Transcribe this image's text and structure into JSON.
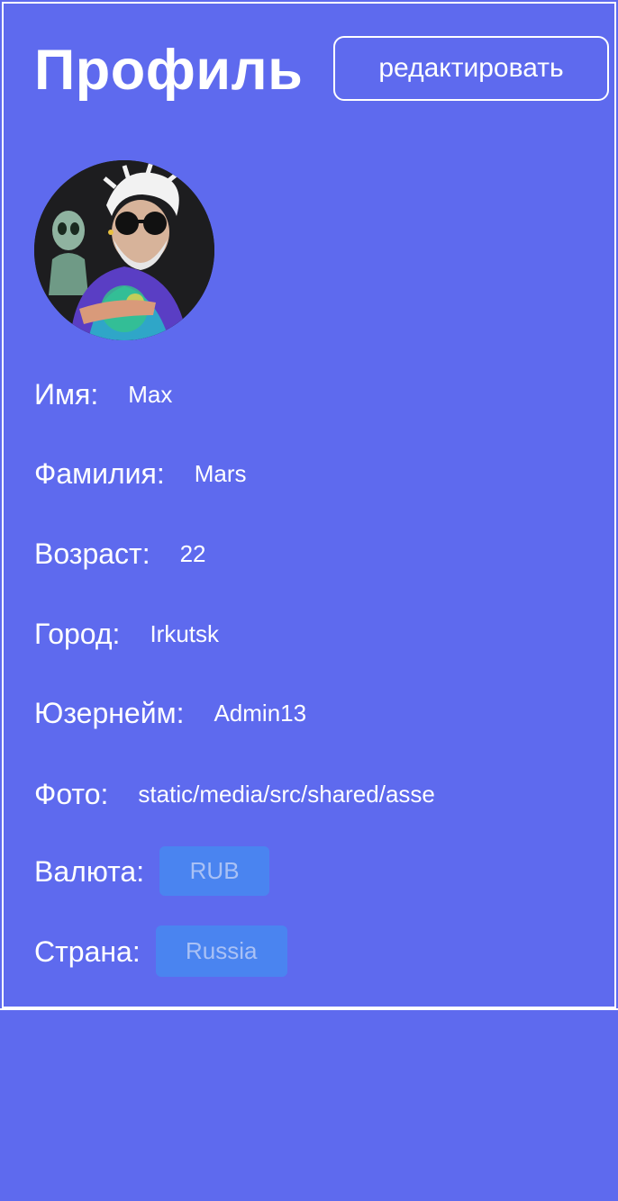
{
  "header": {
    "title": "Профиль",
    "edit_label": "редактировать"
  },
  "avatar": {
    "icon": "avatar-illustration"
  },
  "fields": {
    "first_name": {
      "label": "Имя:",
      "value": "Max"
    },
    "last_name": {
      "label": "Фамилия:",
      "value": "Mars"
    },
    "age": {
      "label": "Возраст:",
      "value": "22"
    },
    "city": {
      "label": "Город:",
      "value": "Irkutsk"
    },
    "username": {
      "label": "Юзернейм:",
      "value": "Admin13"
    },
    "photo": {
      "label": "Фото:",
      "value": "static/media/src/shared/asse"
    },
    "currency": {
      "label": "Валюта:",
      "value": "RUB"
    },
    "country": {
      "label": "Страна:",
      "value": "Russia"
    }
  },
  "colors": {
    "background": "#5e6aee",
    "select_bg": "#4a84f0",
    "select_text": "#a9c1f5",
    "text": "#ffffff"
  }
}
